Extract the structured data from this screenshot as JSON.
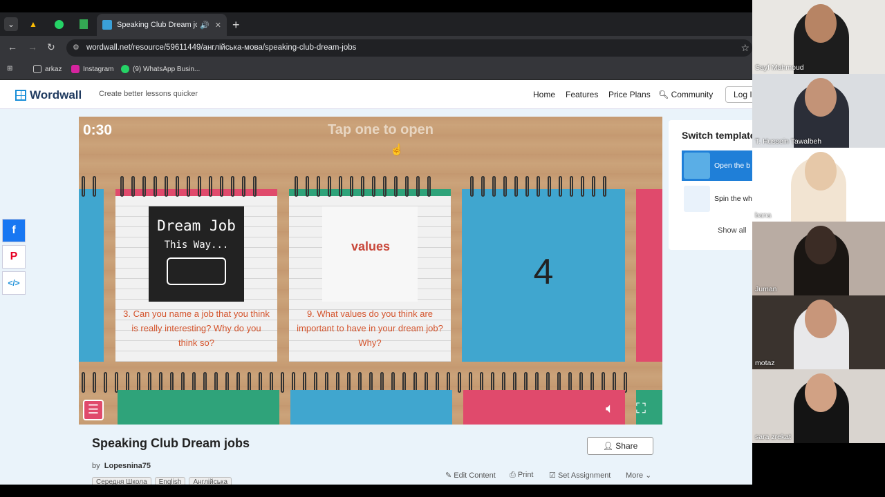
{
  "browser": {
    "tab_title": "Speaking Club Dream jobs",
    "url": "wordwall.net/resource/59611449/англійська-мова/speaking-club-dream-jobs",
    "bookmarks": [
      "arkaz",
      "Instagram",
      "(9) WhatsApp Busin..."
    ]
  },
  "header": {
    "brand": "Wordwall",
    "tagline": "Create better lessons quicker",
    "nav": [
      "Home",
      "Features",
      "Price Plans",
      "Community"
    ],
    "login": "Log In"
  },
  "game": {
    "timer": "0:30",
    "prompt": "Tap one to open",
    "card1_image_line1": "Dream Job",
    "card1_image_line2": "This Way...",
    "card1_question": "3. Can you name a job that you think is really interesting? Why do you think so?",
    "card2_image_word": "values",
    "card2_question": "9. What values do you think are important to have in your dream job? Why?",
    "card3_number": "4"
  },
  "switch_template": {
    "title": "Switch template",
    "items": [
      "Open the b",
      "Spin the wh"
    ],
    "show_all": "Show all"
  },
  "resource": {
    "title": "Speaking Club Dream jobs",
    "share": "Share",
    "by_prefix": "by",
    "author": "Lopesnina75",
    "actions": [
      "Edit Content",
      "Print",
      "Set Assignment",
      "More"
    ],
    "tags": [
      "Середня Школа",
      "English",
      "Англійська"
    ]
  },
  "participants": [
    "Sayf Mahmoud",
    "T. Hussein Tawalbeh",
    "bana",
    "Juman",
    "motaz",
    "sara zrekat"
  ],
  "colors": {
    "pink": "#e04a6c",
    "green": "#2fa37a",
    "blue": "#40a6cf",
    "wood": "#c69b72"
  }
}
